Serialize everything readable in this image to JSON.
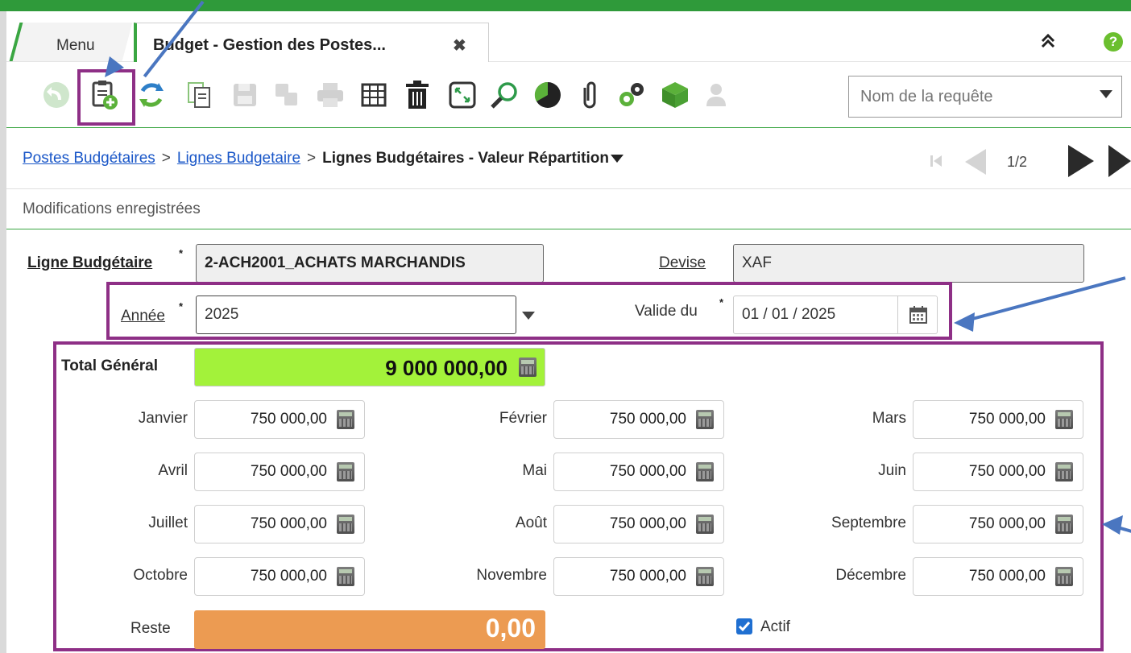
{
  "tabs": {
    "menu_label": "Menu",
    "active_label": "Budget - Gestion des Postes...",
    "close_symbol": "✖"
  },
  "header_icons": {
    "collapse": "⌃",
    "help": "?"
  },
  "toolbar": {
    "icons": [
      "back-icon",
      "new-record-icon",
      "refresh-icon",
      "duplicate-icon",
      "save-icon",
      "save-copy-icon",
      "print-icon",
      "grid-view-icon",
      "delete-icon",
      "fullscreen-icon",
      "search-icon",
      "chart-icon",
      "attachment-icon",
      "settings-icon",
      "package-icon",
      "user-settings-icon"
    ],
    "query_placeholder": "Nom de la requête"
  },
  "breadcrumb": {
    "link1": "Postes Budgétaires",
    "sep": ">",
    "link2": "Lignes Budgetaire",
    "current": "Lignes Budgétaires - Valeur Répartition"
  },
  "pager": {
    "count": "1/2"
  },
  "status_message": "Modifications enregistrées",
  "form": {
    "ligne_label": "Ligne Budgétaire",
    "ligne_value": "2-ACH2001_ACHATS MARCHANDIS",
    "devise_label": "Devise",
    "devise_value": "XAF",
    "annee_label": "Année",
    "annee_value": "2025",
    "valide_label": "Valide du",
    "valide_value": "01 / 01 / 2025",
    "required_mark": "*"
  },
  "totals": {
    "total_label": "Total Général",
    "total_value": "9 000 000,00",
    "reste_label": "Reste",
    "reste_value": "0,00",
    "actif_label": "Actif",
    "actif_checked": true
  },
  "months": [
    {
      "label": "Janvier",
      "value": "750 000,00"
    },
    {
      "label": "Février",
      "value": "750 000,00"
    },
    {
      "label": "Mars",
      "value": "750 000,00"
    },
    {
      "label": "Avril",
      "value": "750 000,00"
    },
    {
      "label": "Mai",
      "value": "750 000,00"
    },
    {
      "label": "Juin",
      "value": "750 000,00"
    },
    {
      "label": "Juillet",
      "value": "750 000,00"
    },
    {
      "label": "Août",
      "value": "750 000,00"
    },
    {
      "label": "Septembre",
      "value": "750 000,00"
    },
    {
      "label": "Octobre",
      "value": "750 000,00"
    },
    {
      "label": "Novembre",
      "value": "750 000,00"
    },
    {
      "label": "Décembre",
      "value": "750 000,00"
    }
  ],
  "colors": {
    "brand_green": "#2f9a3a",
    "annotation_purple": "#8e2f86",
    "annotation_arrow": "#4a76c0",
    "total_bg": "#a3f23a",
    "reste_bg": "#ec9b52",
    "link_blue": "#1a57c8"
  }
}
